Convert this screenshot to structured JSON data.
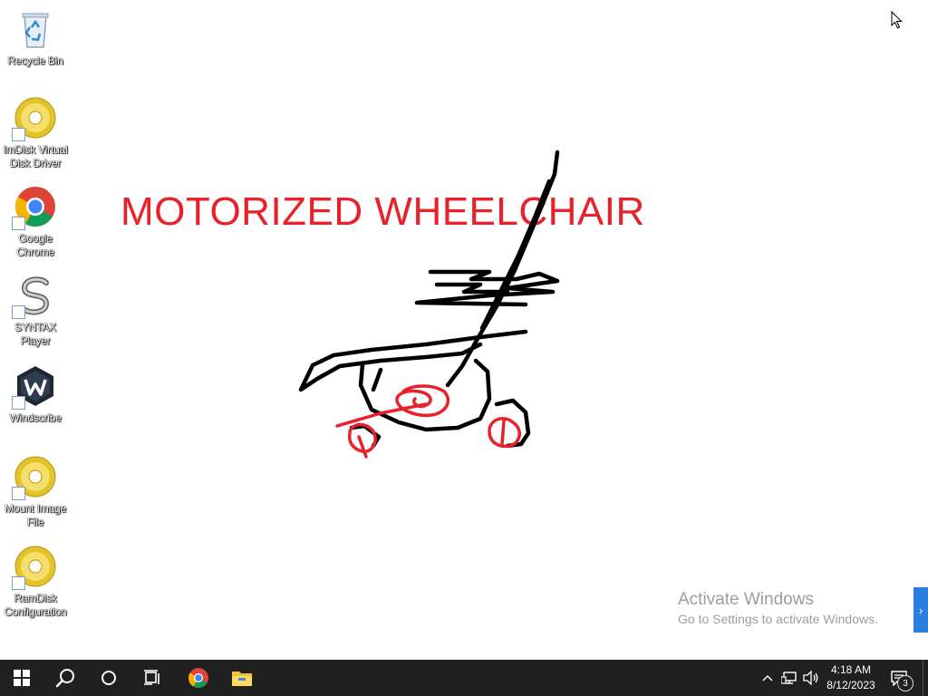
{
  "desktop": {
    "icons": [
      {
        "label": "Recycle Bin",
        "icon": "recycle-bin-icon"
      },
      {
        "label": "ImDisk Virtual Disk Driver",
        "icon": "disc-icon"
      },
      {
        "label": "Google Chrome",
        "icon": "chrome-icon"
      },
      {
        "label": "SYNTAX Player",
        "icon": "syntax-s-icon"
      },
      {
        "label": "Windscribe",
        "icon": "windscribe-icon"
      },
      {
        "label": "Mount Image File",
        "icon": "disc-icon"
      },
      {
        "label": "RamDisk Configuration",
        "icon": "disc-icon"
      }
    ],
    "drawing": {
      "title": "MOTORIZED WHEELCHAIR",
      "colors": {
        "title": "#e8212b",
        "ink": "#000000",
        "wheels": "#e8212b"
      }
    }
  },
  "watermark": {
    "title": "Activate Windows",
    "subtitle": "Go to Settings to activate Windows."
  },
  "taskbar": {
    "buttons": [
      "windows-start-icon",
      "search-icon",
      "cortana-icon",
      "task-view-icon",
      "chrome-icon",
      "file-explorer-icon"
    ],
    "tray": [
      "chevron-up-icon",
      "network-icon",
      "volume-icon"
    ],
    "clock": {
      "time": "4:18 AM",
      "date": "8/12/2023"
    },
    "notifications": {
      "count": "3"
    }
  }
}
